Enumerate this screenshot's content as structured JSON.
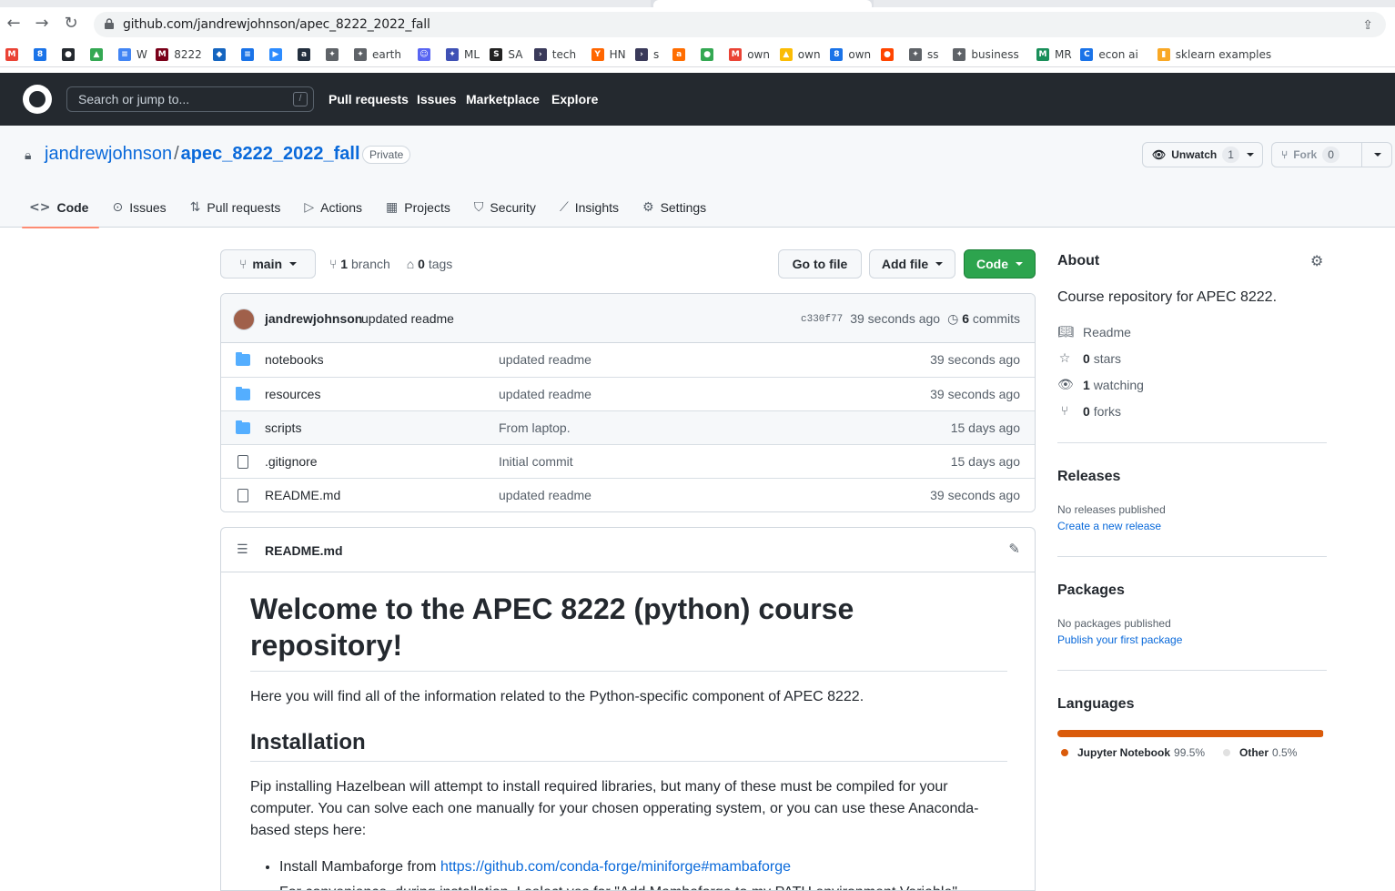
{
  "browser": {
    "url": "github.com/jandrewjohnson/apec_8222_2022_fall",
    "bookmarks": [
      {
        "label": "",
        "icon": "gmail-icon",
        "color": "#ea4335"
      },
      {
        "label": "",
        "icon": "calendar-icon",
        "color": "#1a73e8"
      },
      {
        "label": "",
        "icon": "github-icon",
        "color": "#24292f"
      },
      {
        "label": "",
        "icon": "drive-icon",
        "color": "#34a853"
      },
      {
        "label": "W",
        "icon": "docs-icon",
        "color": "#4285f4"
      },
      {
        "label": "8222",
        "icon": "umn-icon",
        "color": "#7a0019"
      },
      {
        "label": "",
        "icon": "cap-icon",
        "color": "#1565c0"
      },
      {
        "label": "",
        "icon": "forms-icon",
        "color": "#1a73e8"
      },
      {
        "label": "",
        "icon": "zoom-icon",
        "color": "#2d8cff"
      },
      {
        "label": "",
        "icon": "amazon-icon",
        "color": "#232f3e"
      },
      {
        "label": "",
        "icon": "bird-icon",
        "color": "#5f6368"
      },
      {
        "label": "earth",
        "icon": "bird-icon",
        "color": "#5f6368"
      },
      {
        "label": "",
        "icon": "discord-icon",
        "color": "#5865f2"
      },
      {
        "label": "ML",
        "icon": "bird-icon",
        "color": "#3f51b5"
      },
      {
        "label": "SA",
        "icon": "sa-icon",
        "color": "#222222"
      },
      {
        "label": "tech",
        "icon": "arrow-icon",
        "color": "#3a3a5a"
      },
      {
        "label": "HN",
        "icon": "hn-icon",
        "color": "#ff6600"
      },
      {
        "label": "s",
        "icon": "arrow-icon",
        "color": "#3a3a5a"
      },
      {
        "label": "",
        "icon": "aws-icon",
        "color": "#ff6d00"
      },
      {
        "label": "",
        "icon": "maps-icon",
        "color": "#34a853"
      },
      {
        "label": "own",
        "icon": "gmail-icon",
        "color": "#ea4335"
      },
      {
        "label": "own",
        "icon": "drive-icon",
        "color": "#fbbc04"
      },
      {
        "label": "own",
        "icon": "calendar-icon",
        "color": "#1a73e8"
      },
      {
        "label": "",
        "icon": "reddit-icon",
        "color": "#ff4500"
      },
      {
        "label": "ss",
        "icon": "bird-icon",
        "color": "#5f6368"
      },
      {
        "label": "business",
        "icon": "bird-icon",
        "color": "#5f6368"
      },
      {
        "label": "MR",
        "icon": "mr-icon",
        "color": "#1a8f5a"
      },
      {
        "label": "econ ai",
        "icon": "c-icon",
        "color": "#1a73e8"
      },
      {
        "label": "sklearn examples",
        "icon": "chart-icon",
        "color": "#f9a825"
      }
    ]
  },
  "header": {
    "search_placeholder": "Search or jump to...",
    "search_key": "/",
    "nav": [
      "Pull requests",
      "Issues",
      "Marketplace",
      "Explore"
    ]
  },
  "repo": {
    "owner": "jandrewjohnson",
    "separator": "/",
    "name": "apec_8222_2022_fall",
    "visibility": "Private",
    "unwatch_label": "Unwatch",
    "watch_count": "1",
    "fork_label": "Fork",
    "fork_count": "0",
    "tabs": [
      {
        "label": "Code",
        "icon": "<>"
      },
      {
        "label": "Issues",
        "icon": "⊙"
      },
      {
        "label": "Pull requests",
        "icon": "⇅"
      },
      {
        "label": "Actions",
        "icon": "▷"
      },
      {
        "label": "Projects",
        "icon": "▦"
      },
      {
        "label": "Security",
        "icon": "⛉"
      },
      {
        "label": "Insights",
        "icon": "⟋"
      },
      {
        "label": "Settings",
        "icon": "⚙"
      }
    ]
  },
  "toolbar": {
    "branch": "main",
    "branch_count": "1",
    "branch_word": "branch",
    "tag_count": "0",
    "tag_word": "tags",
    "go_to_file": "Go to file",
    "add_file": "Add file",
    "code": "Code"
  },
  "commit": {
    "author": "jandrewjohnson",
    "message": "updated readme",
    "sha": "c330f77",
    "time": "39 seconds ago",
    "commit_count": "6",
    "commits_word": "commits"
  },
  "files": [
    {
      "name": "notebooks",
      "type": "dir",
      "message": "updated readme",
      "age": "39 seconds ago"
    },
    {
      "name": "resources",
      "type": "dir",
      "message": "updated readme",
      "age": "39 seconds ago"
    },
    {
      "name": "scripts",
      "type": "dir",
      "message": "From laptop.",
      "age": "15 days ago"
    },
    {
      "name": ".gitignore",
      "type": "file",
      "message": "Initial commit",
      "age": "15 days ago"
    },
    {
      "name": "README.md",
      "type": "file",
      "message": "updated readme",
      "age": "39 seconds ago"
    }
  ],
  "readme": {
    "filename": "README.md",
    "h1": "Welcome to the APEC 8222 (python) course repository!",
    "intro": "Here you will find all of the information related to the Python-specific component of APEC 8222.",
    "h2": "Installation",
    "install_p": "Pip installing Hazelbean will attempt to install required libraries, but many of these must be compiled for your computer. You can solve each one manually for your chosen opperating system, or you can use these Anaconda-based steps here:",
    "bullet1_text": "Install Mambaforge from ",
    "bullet1_link": "https://github.com/conda-forge/miniforge#mambaforge",
    "bullet2": "For convenience, during installation, I select yes for \"Add Mambaforge to my PATH environment Variable\""
  },
  "about": {
    "heading": "About",
    "description": "Course repository for APEC 8222.",
    "readme": "Readme",
    "stars_count": "0",
    "stars_word": "stars",
    "watching_count": "1",
    "watching_word": "watching",
    "forks_count": "0",
    "forks_word": "forks"
  },
  "releases": {
    "heading": "Releases",
    "empty": "No releases published",
    "link": "Create a new release"
  },
  "packages": {
    "heading": "Packages",
    "empty": "No packages published",
    "link": "Publish your first package"
  },
  "languages": {
    "heading": "Languages",
    "items": [
      {
        "name": "Jupyter Notebook",
        "percent": "99.5%",
        "value": 99.5,
        "color": "#da5b0b"
      },
      {
        "name": "Other",
        "percent": "0.5%",
        "value": 0.5,
        "color": "#ededed"
      }
    ]
  },
  "colors": {
    "header_bg": "#24292f",
    "link": "#0969da",
    "green_button": "#2da44e",
    "selected_tab_underline": "#fd8c73"
  }
}
